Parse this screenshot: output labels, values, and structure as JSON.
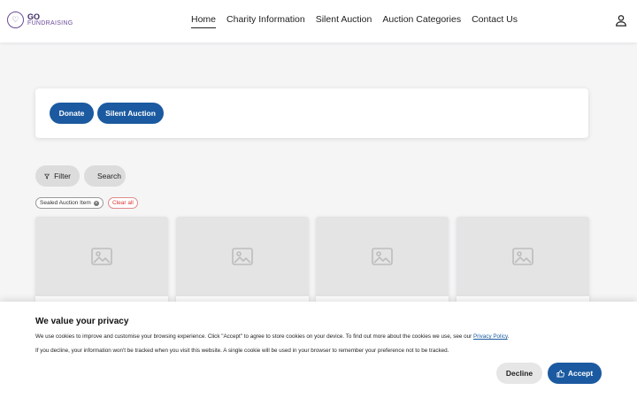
{
  "logo": {
    "go": "GO",
    "sub": "FUNDRAISING"
  },
  "nav": {
    "items": [
      {
        "label": "Home",
        "active": true
      },
      {
        "label": "Charity Information",
        "active": false
      },
      {
        "label": "Silent Auction",
        "active": false
      },
      {
        "label": "Auction Categories",
        "active": false
      },
      {
        "label": "Contact Us",
        "active": false
      }
    ]
  },
  "header": {
    "user_icon": "user-icon"
  },
  "actions": {
    "donate_label": "Donate",
    "silent_auction_label": "Silent Auction"
  },
  "tools": {
    "filter_label": "Filter",
    "search_label": "Search"
  },
  "filters": {
    "active_chip": "Sealed Auction Item",
    "clear_label": "Clear all"
  },
  "cards": [
    {
      "image": "image-placeholder-icon"
    },
    {
      "image": "image-placeholder-icon"
    },
    {
      "image": "image-placeholder-icon"
    },
    {
      "image": "image-placeholder-icon"
    }
  ],
  "cookie": {
    "title": "We value your privacy",
    "text1": "We use cookies to improve and customise your browsing experience. Click \"Accept\" to agree to store cookies on your device. To find out more about the cookies we use, see our ",
    "link": "Privacy Policy",
    "text1_end": ".",
    "text2": "If you decline, your information won't be tracked when you visit this website. A single cookie will be used in your browser to remember your preference not to be tracked.",
    "decline_label": "Decline",
    "accept_label": "Accept"
  },
  "colors": {
    "primary": "#1b5aa0",
    "brand": "#6b4c9a",
    "clear": "#d33333"
  }
}
